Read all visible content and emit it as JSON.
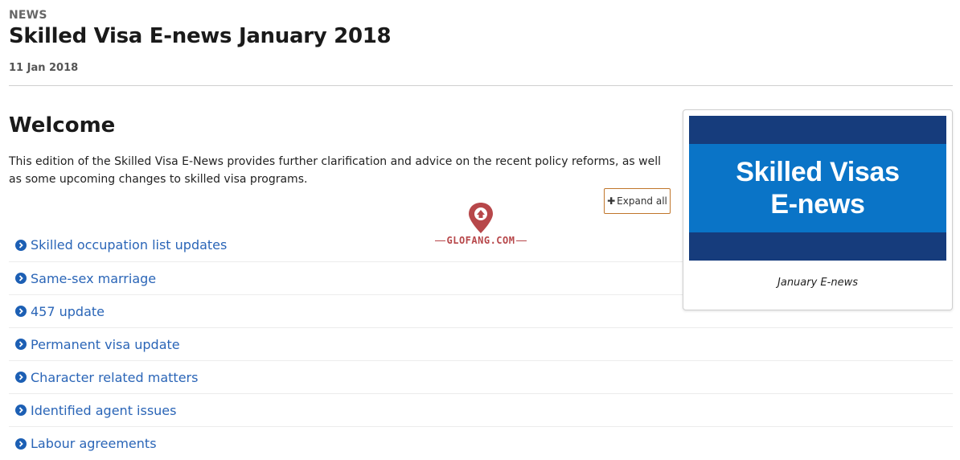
{
  "header": {
    "eyebrow": "NEWS",
    "title": "Skilled Visa E-news January 2018",
    "date": "11 Jan 2018"
  },
  "welcome": {
    "heading": "Welcome",
    "intro": "This edition of the Skilled Visa E-News provides further clarification and advice on the recent policy reforms, as well as some upcoming changes to skilled visa programs."
  },
  "expand_button": {
    "icon": "plus-icon",
    "label": "Expand all"
  },
  "watermark": {
    "text": "GLOFANG.COM",
    "icon": "location-pin-logo"
  },
  "accordion": {
    "icon": "chevron-circle-right-icon",
    "items": [
      {
        "label": "Skilled occupation list updates"
      },
      {
        "label": "Same-sex marriage"
      },
      {
        "label": "457 update"
      },
      {
        "label": "Permanent visa update"
      },
      {
        "label": "Character related matters"
      },
      {
        "label": "Identified agent issues"
      },
      {
        "label": "Labour agreements"
      }
    ]
  },
  "card": {
    "image_line1": "Skilled Visas",
    "image_line2": "E-news",
    "caption": "January E-news"
  },
  "colors": {
    "link": "#2a65b7",
    "icon_blue": "#1c5fb4",
    "button_border": "#c0762b",
    "banner_dark": "#163c7c",
    "banner_light": "#0a74c7",
    "watermark": "#b7474a"
  }
}
